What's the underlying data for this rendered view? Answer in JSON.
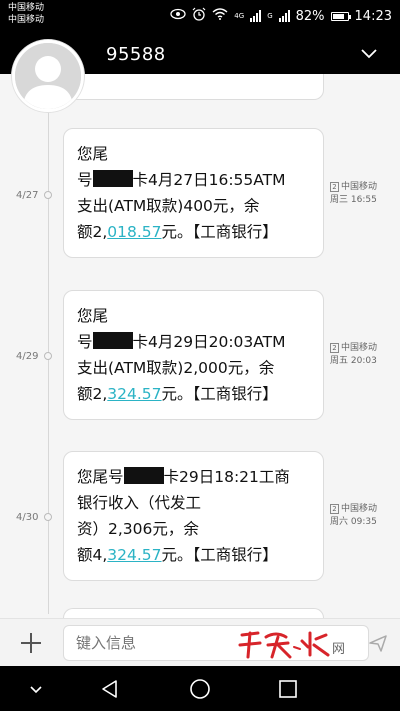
{
  "status_bar": {
    "carrier_1": "中国移动",
    "carrier_2": "中国移动",
    "network_1": "4G",
    "network_2": "G",
    "battery": "82%",
    "battery_level": 0.82,
    "time": "14:23"
  },
  "header": {
    "title": "95588"
  },
  "messages": [
    {
      "date": "4/27",
      "text_1": "您尾",
      "text_2a": "号",
      "text_2b": "卡4月27日16:55ATM",
      "text_3": "支出(ATM取款)400元，余",
      "text_4a": "额2,",
      "text_4b": "018.57",
      "text_4c": "元。【工商银行】",
      "sim": "2",
      "carrier": "中国移动",
      "time": "周三 16:55"
    },
    {
      "date": "4/29",
      "text_1": "您尾",
      "text_2a": "号",
      "text_2b": "卡4月29日20:03ATM",
      "text_3": "支出(ATM取款)2,000元，余",
      "text_4a": "额2,",
      "text_4b": "324.57",
      "text_4c": "元。【工商银行】",
      "sim": "2",
      "carrier": "中国移动",
      "time": "周五 20:03"
    },
    {
      "date": "4/30",
      "text_1a": "您尾号",
      "text_1b": "卡29日18:21工商",
      "text_2": "银行收入（代发工",
      "text_3": "资）2,306元，余",
      "text_4a": "额4,",
      "text_4b": "324.57",
      "text_4c": "元。【工商银行】",
      "sim": "2",
      "carrier": "中国移动",
      "time": "周六 09:35"
    }
  ],
  "composer": {
    "placeholder": "键入信息",
    "watermark": "天水网"
  },
  "icons": {
    "chevron": "chevron-down-icon",
    "plus": "plus-icon",
    "send": "send-icon",
    "nav": [
      "hide-keyboard-icon",
      "back-icon",
      "home-icon",
      "recents-icon"
    ]
  },
  "colors": {
    "link": "#2bb3c5",
    "watermark": "#d7242a"
  }
}
